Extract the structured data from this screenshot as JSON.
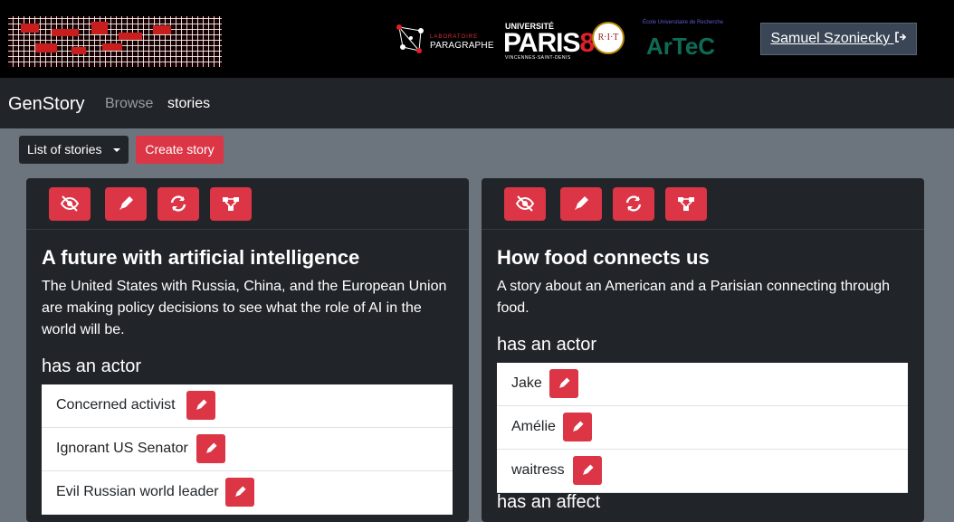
{
  "header": {
    "logo_lp_small": "LABORATOIRE",
    "logo_lp": "PARAGRAPHE",
    "logo_p8_top": "UNIVERSITÉ",
    "logo_p8_main": "PARIS",
    "logo_p8_num": "8",
    "logo_p8_sub": "VINCENNES-SAINT-DENIS",
    "logo_rit": "R·I·T",
    "logo_artec_small": "École Universitaire de Recherche",
    "logo_artec": "ArTeC",
    "user_name": "Samuel Szoniecky",
    "logout_icon": "sign-out-icon"
  },
  "navbar": {
    "brand": "GenStory",
    "browse": "Browse",
    "stories": "stories"
  },
  "toolbar": {
    "list_label": "List of stories",
    "create_label": "Create story"
  },
  "card_icons": [
    "eye-slash-icon",
    "pen-icon",
    "refresh-icon",
    "graph-icon"
  ],
  "stories": [
    {
      "title": "A future with artificial intelligence",
      "description": "The United States with Russia, China, and the European Union are making policy decisions to see what the role of AI in the world will be.",
      "actor_heading": "has an actor",
      "actors": [
        "Concerned activist",
        "Ignorant US Senator",
        "Evil Russian world leader"
      ]
    },
    {
      "title": "How food connects us",
      "description": "A story about an American and a Parisian connecting through food.",
      "actor_heading": "has an actor",
      "actors": [
        "Jake",
        "Amélie",
        "waitress"
      ],
      "affect_heading": "has an affect"
    }
  ],
  "colors": {
    "accent": "#dc3545",
    "dark": "#212529",
    "page": "#6c757d"
  }
}
